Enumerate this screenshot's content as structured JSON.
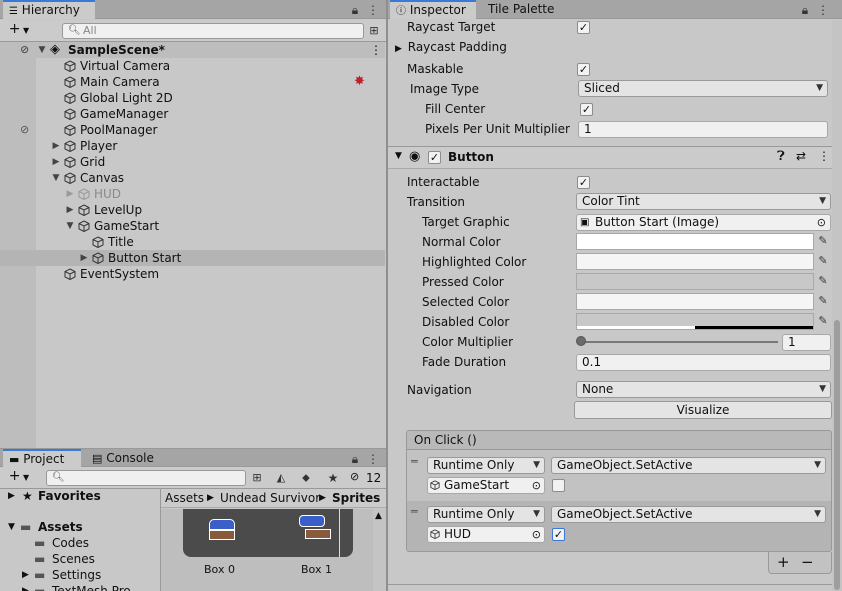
{
  "hierarchy": {
    "tab_label": "Hierarchy",
    "add_label": "+",
    "search_placeholder": "All",
    "scene_name": "SampleScene*",
    "items": [
      {
        "label": "Virtual Camera"
      },
      {
        "label": "Main Camera"
      },
      {
        "label": "Global Light 2D"
      },
      {
        "label": "GameManager"
      },
      {
        "label": "PoolManager"
      },
      {
        "label": "Player"
      },
      {
        "label": "Grid"
      },
      {
        "label": "Canvas"
      },
      {
        "label": "HUD"
      },
      {
        "label": "LevelUp"
      },
      {
        "label": "GameStart"
      },
      {
        "label": "Title"
      },
      {
        "label": "Button Start"
      },
      {
        "label": "EventSystem"
      }
    ]
  },
  "project": {
    "tab_label": "Project",
    "console_label": "Console",
    "add_label": "+",
    "hidden_count": "12",
    "tree": {
      "favorites": "Favorites",
      "assets": "Assets",
      "folders": [
        "Codes",
        "Scenes",
        "Settings",
        "TextMesh Pro"
      ]
    },
    "breadcrumb": [
      "Assets",
      "Undead Survivor",
      "Sprites"
    ],
    "sprites": [
      "Box 0",
      "Box 1"
    ]
  },
  "inspector": {
    "tab_label": "Inspector",
    "tile_palette_label": "Tile Palette",
    "image": {
      "raycast_target": "Raycast Target",
      "raycast_padding": "Raycast Padding",
      "maskable": "Maskable",
      "image_type_label": "Image Type",
      "image_type_value": "Sliced",
      "fill_center": "Fill Center",
      "ppu_label": "Pixels Per Unit Multiplier",
      "ppu_value": "1"
    },
    "button": {
      "title": "Button",
      "interactable": "Interactable",
      "transition_label": "Transition",
      "transition_value": "Color Tint",
      "target_graphic_label": "Target Graphic",
      "target_graphic_value": "Button Start (Image)",
      "normal_color": "Normal Color",
      "highlighted_color": "Highlighted Color",
      "pressed_color": "Pressed Color",
      "selected_color": "Selected Color",
      "disabled_color": "Disabled Color",
      "color_multiplier_label": "Color Multiplier",
      "color_multiplier_value": "1",
      "fade_duration_label": "Fade Duration",
      "fade_duration_value": "0.1",
      "navigation_label": "Navigation",
      "navigation_value": "None",
      "visualize_label": "Visualize",
      "onclick_label": "On Click ()",
      "events": [
        {
          "runtime": "Runtime Only",
          "function": "GameObject.SetActive",
          "object": "GameStart",
          "checked": false
        },
        {
          "runtime": "Runtime Only",
          "function": "GameObject.SetActive",
          "object": "HUD",
          "checked": true
        }
      ],
      "plus": "+",
      "minus": "−"
    }
  },
  "colors": {
    "accent": "#3a79d8",
    "selected_row": "#b4b4b4",
    "panel": "#c8c8c8"
  }
}
